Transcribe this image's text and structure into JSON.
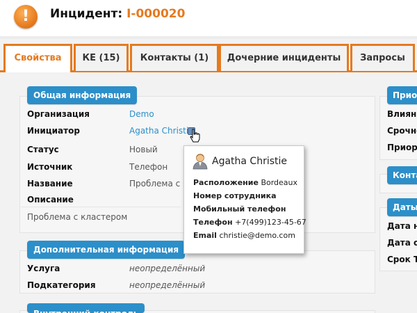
{
  "header": {
    "title_prefix": "Инцидент:",
    "title_ref": "I-000020",
    "alert_icon_glyph": "!"
  },
  "tabs": [
    {
      "label": "Свойства",
      "active": true
    },
    {
      "label": "КЕ (15)",
      "active": false
    },
    {
      "label": "Контакты (1)",
      "active": false
    },
    {
      "label": "Дочерние инциденты",
      "active": false
    },
    {
      "label": "Запросы",
      "active": false
    }
  ],
  "general": {
    "section_title": "Общая информация",
    "organization_label": "Организация",
    "organization_value": "Demo",
    "initiator_label": "Инициатор",
    "initiator_value": "Agatha Christie",
    "status_label": "Статус",
    "status_value": "Новый",
    "source_label": "Источник",
    "source_value": "Телефон",
    "name_label": "Название",
    "name_value": "Проблема с кластером",
    "description_label": "Описание",
    "description_value": "Проблема с кластером"
  },
  "additional": {
    "section_title": "Дополнительная информация",
    "service_label": "Услуга",
    "service_value": "неопределённый",
    "subcategory_label": "Подкатегория",
    "subcategory_value": "неопределённый"
  },
  "internal": {
    "section_title": "Внутренний контроль"
  },
  "right": {
    "priority_title": "Приор",
    "impact_label": "Влияни",
    "urgency_label": "Срочно",
    "priority_label": "Приори",
    "contacts_title": "Конта",
    "dates_title": "Даты",
    "date1_label": "Дата н",
    "date2_label": "Дата об",
    "term_label": "Срок Т"
  },
  "popup": {
    "name": "Agatha Christie",
    "location_label": "Расположение",
    "location_value": "Bordeaux",
    "employee_number_label": "Номер сотрудника",
    "mobile_label": "Мобильный телефон",
    "phone_label": "Телефон",
    "phone_value": "+7(499)123-45-67",
    "email_label": "Email",
    "email_value": "christie@demo.com"
  },
  "colors": {
    "accent_orange": "#e57a1f",
    "section_blue": "#2c8fc9",
    "link_blue": "#2c8fc9"
  }
}
